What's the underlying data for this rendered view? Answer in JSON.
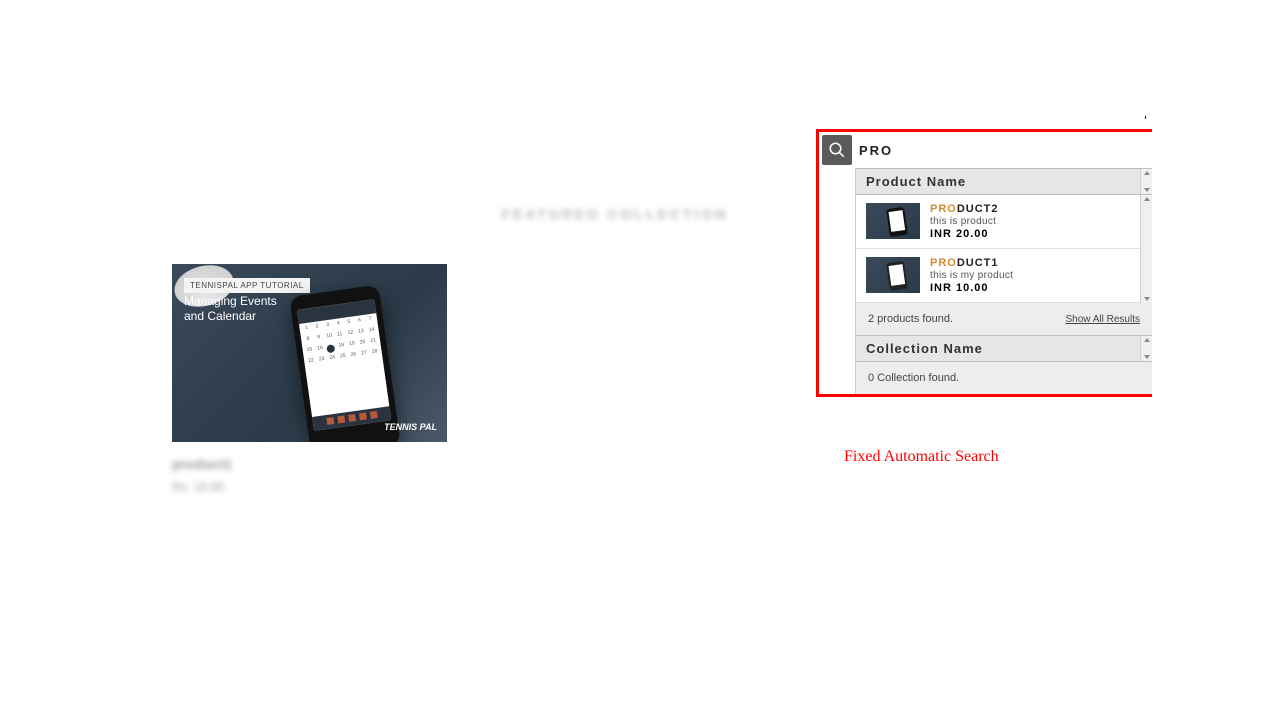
{
  "background": {
    "heading": "FEATURED COLLECTION",
    "product_name": "product1",
    "product_price": "Rs. 10.00",
    "card": {
      "strip": "TENNISPAL APP TUTORIAL",
      "title_line1": "Managing Events",
      "title_line2": "and Calendar",
      "logo": "TENNIS PAL"
    }
  },
  "search_widget": {
    "query": "PRO",
    "header_products": "Product Name",
    "header_collections": "Collection Name",
    "results": [
      {
        "highlight": "PRO",
        "rest": "DUCT2",
        "desc": "this is product",
        "price": "INR 20.00"
      },
      {
        "highlight": "PRO",
        "rest": "DUCT1",
        "desc": "this is my product",
        "price": "INR 10.00"
      }
    ],
    "products_found": "2 products found.",
    "show_all": "Show All Results",
    "collections_found": "0 Collection found."
  },
  "annotation": "Fixed Automatic Search"
}
